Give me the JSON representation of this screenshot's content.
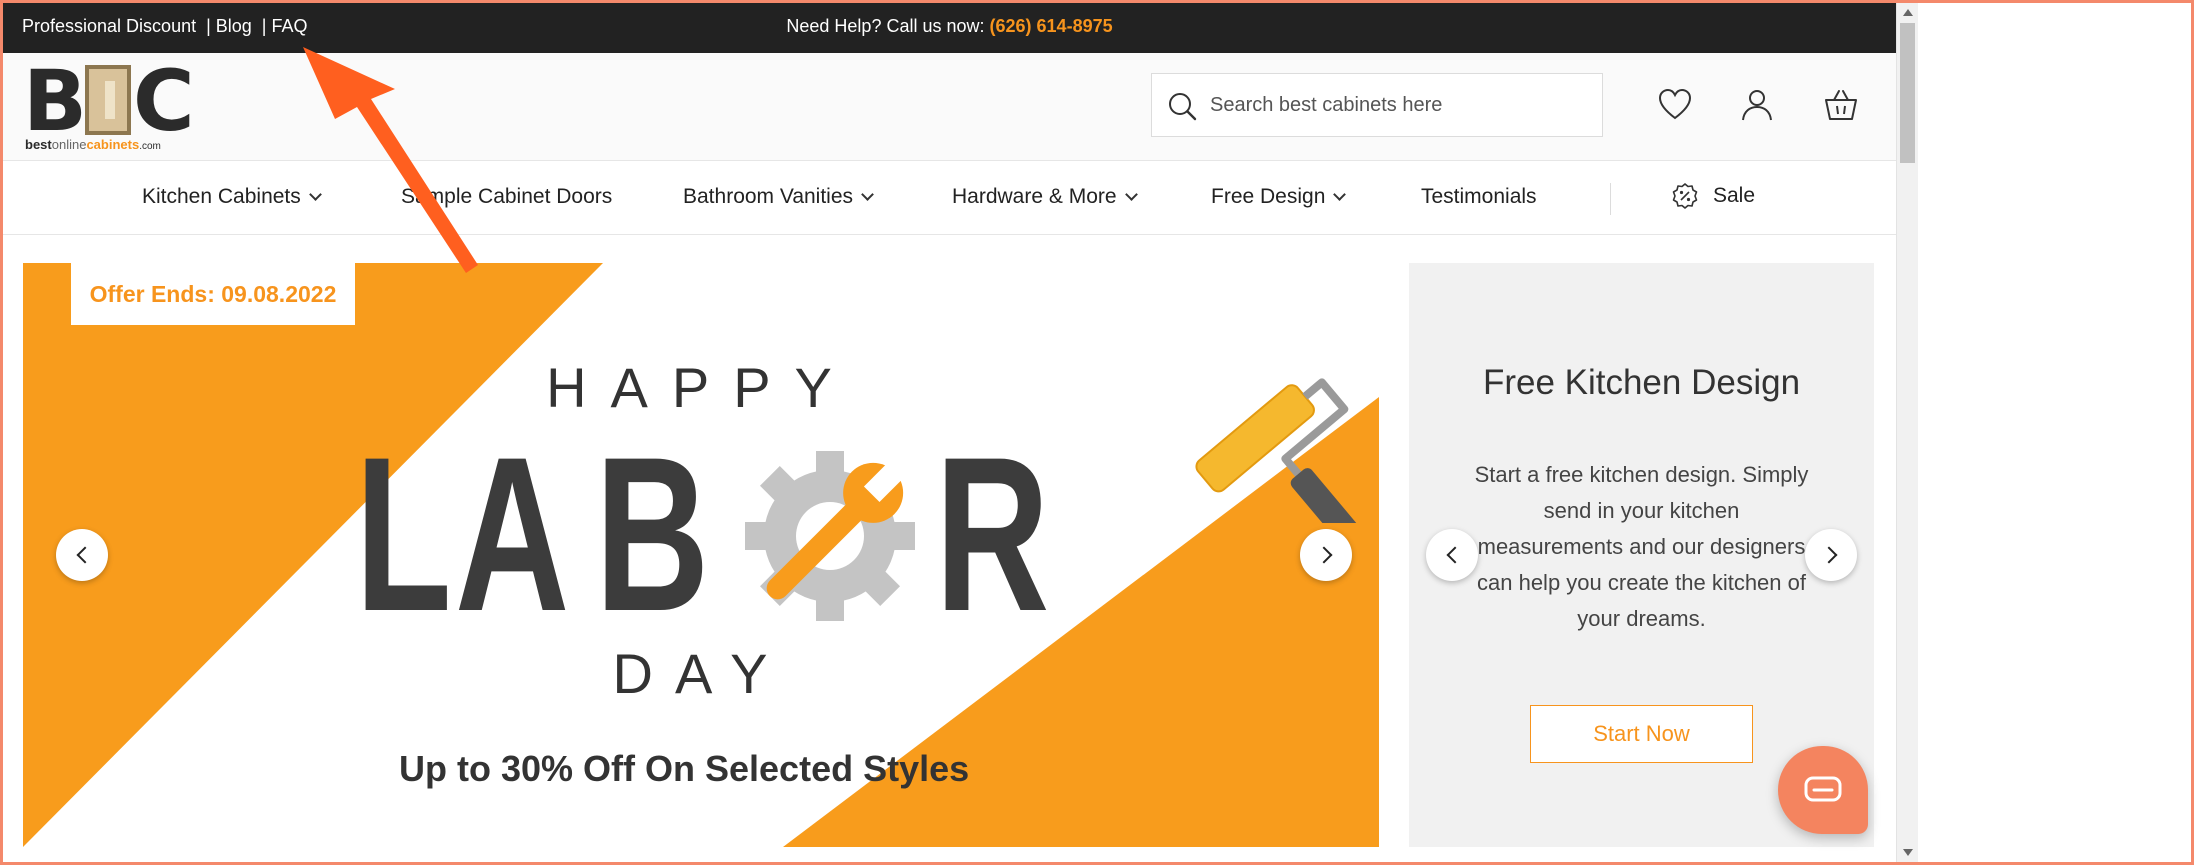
{
  "topbar": {
    "links": [
      "Professional Discount",
      "| Blog",
      "| FAQ"
    ],
    "help_text": "Need Help? Call us now:",
    "phone": "(626) 614-8975"
  },
  "logo": {
    "letters": [
      "B",
      "C"
    ],
    "tagline_parts": [
      "best",
      "online",
      "cabinets",
      ".com"
    ]
  },
  "search": {
    "placeholder": "Search best cabinets here",
    "icon": "search-icon"
  },
  "header_icons": [
    "heart-icon",
    "user-icon",
    "basket-icon"
  ],
  "nav": {
    "items": [
      {
        "label": "Kitchen Cabinets",
        "dropdown": true
      },
      {
        "label": "Sample Cabinet Doors",
        "dropdown": false
      },
      {
        "label": "Bathroom Vanities",
        "dropdown": true
      },
      {
        "label": "Hardware & More",
        "dropdown": true
      },
      {
        "label": "Free Design",
        "dropdown": true
      },
      {
        "label": "Testimonials",
        "dropdown": false
      }
    ],
    "sale_label": "Sale",
    "sale_icon": "percent-badge-icon"
  },
  "banner": {
    "offer": "Offer Ends: 09.08.2022",
    "line1": "HAPPY",
    "line2_letters": [
      "L",
      "A",
      "B",
      "R"
    ],
    "line3": "DAY",
    "tagline": "Up to 30% Off On Selected Styles"
  },
  "side_panel": {
    "title": "Free Kitchen Design",
    "text": "Start a free kitchen design. Simply send in your kitchen measurements and our designers can help you create the kitchen of your dreams.",
    "button": "Start Now"
  },
  "colors": {
    "accent": "#f7941d",
    "topbar_bg": "#222222",
    "chat_bg": "#f4845f",
    "annotation_arrow": "#ff5f1f"
  }
}
